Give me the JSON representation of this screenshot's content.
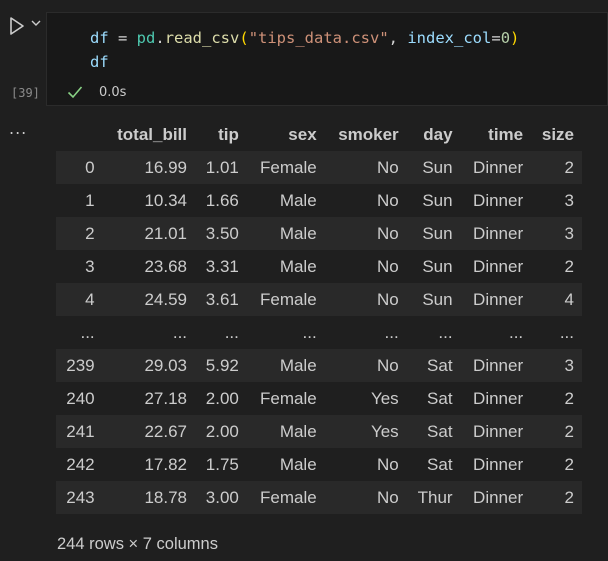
{
  "cell": {
    "execution_count": "[39]",
    "code": {
      "line1": {
        "var": "df",
        "op": " = ",
        "module": "pd",
        "dot": ".",
        "func": "read_csv",
        "paren_open": "(",
        "arg_str": "\"tips_data.csv\"",
        "comma": ", ",
        "kw": "index_col",
        "eq": "=",
        "num": "0",
        "paren_close": ")"
      },
      "line2": "df"
    },
    "status": "0.0s",
    "status_color": "#89d185"
  },
  "output": {
    "menu_label": "...",
    "table": {
      "columns": [
        "",
        "total_bill",
        "tip",
        "sex",
        "smoker",
        "day",
        "time",
        "size"
      ],
      "rows": [
        [
          "0",
          "16.99",
          "1.01",
          "Female",
          "No",
          "Sun",
          "Dinner",
          "2"
        ],
        [
          "1",
          "10.34",
          "1.66",
          "Male",
          "No",
          "Sun",
          "Dinner",
          "3"
        ],
        [
          "2",
          "21.01",
          "3.50",
          "Male",
          "No",
          "Sun",
          "Dinner",
          "3"
        ],
        [
          "3",
          "23.68",
          "3.31",
          "Male",
          "No",
          "Sun",
          "Dinner",
          "2"
        ],
        [
          "4",
          "24.59",
          "3.61",
          "Female",
          "No",
          "Sun",
          "Dinner",
          "4"
        ],
        [
          "...",
          "...",
          "...",
          "...",
          "...",
          "...",
          "...",
          "..."
        ],
        [
          "239",
          "29.03",
          "5.92",
          "Male",
          "No",
          "Sat",
          "Dinner",
          "3"
        ],
        [
          "240",
          "27.18",
          "2.00",
          "Female",
          "Yes",
          "Sat",
          "Dinner",
          "2"
        ],
        [
          "241",
          "22.67",
          "2.00",
          "Male",
          "Yes",
          "Sat",
          "Dinner",
          "2"
        ],
        [
          "242",
          "17.82",
          "1.75",
          "Male",
          "No",
          "Sat",
          "Dinner",
          "2"
        ],
        [
          "243",
          "18.78",
          "3.00",
          "Female",
          "No",
          "Thur",
          "Dinner",
          "2"
        ]
      ]
    },
    "shape": "244 rows × 7 columns"
  },
  "icons": {
    "run": "run-icon",
    "chevron": "chevron-down-icon",
    "check": "check-icon"
  }
}
